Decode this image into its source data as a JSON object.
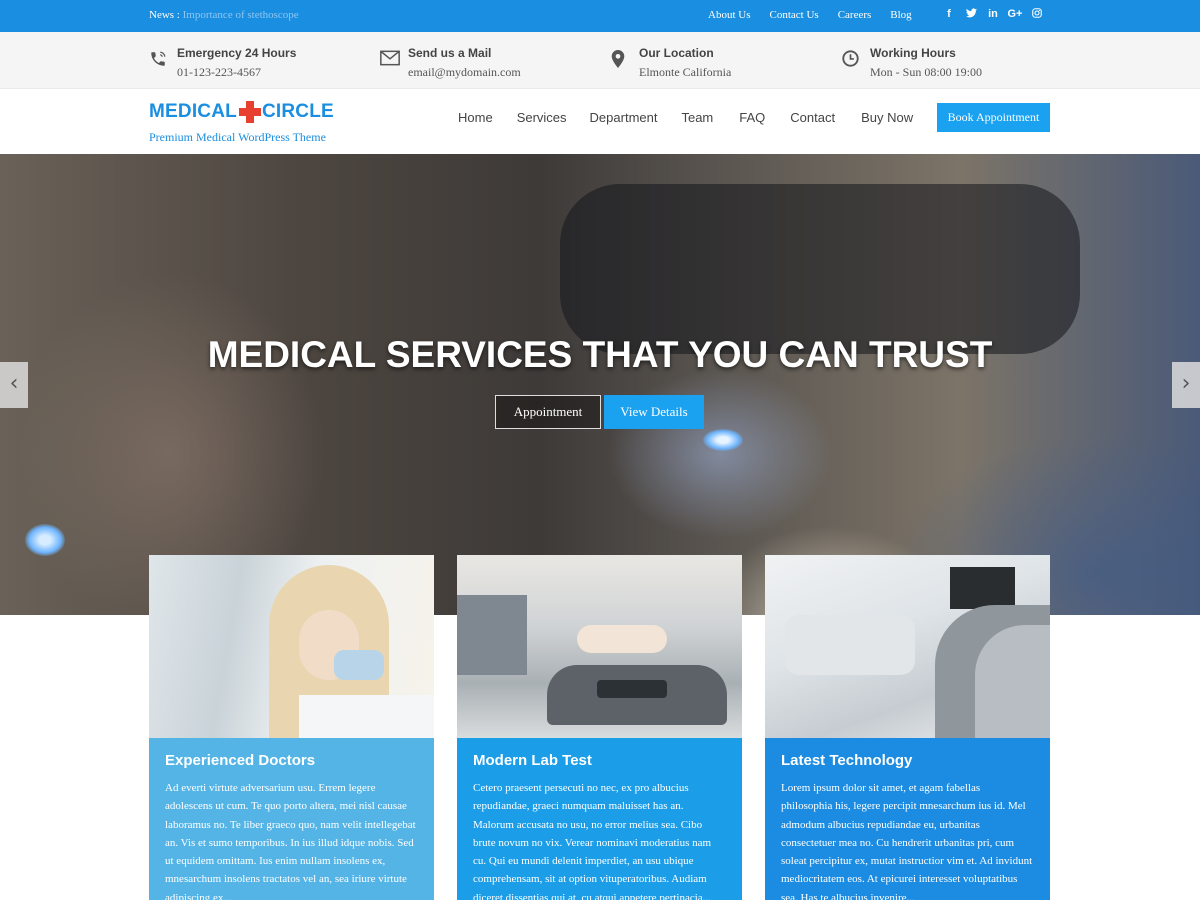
{
  "topbar": {
    "news_label": "News :",
    "news_text": "Importance of stethoscope",
    "links": [
      "About Us",
      "Contact Us",
      "Careers",
      "Blog"
    ],
    "social_icons": [
      "facebook-icon",
      "twitter-icon",
      "linkedin-icon",
      "google-plus-icon",
      "instagram-icon"
    ],
    "social_glyphs": [
      "f",
      "t",
      "in",
      "G+",
      "◎"
    ]
  },
  "info": [
    {
      "icon": "phone-icon",
      "title": "Emergency 24 Hours",
      "value": "01-123-223-4567"
    },
    {
      "icon": "mail-icon",
      "title": "Send us a Mail",
      "value": "email@mydomain.com"
    },
    {
      "icon": "location-pin-icon",
      "title": "Our Location",
      "value": "Elmonte California"
    },
    {
      "icon": "clock-icon",
      "title": "Working Hours",
      "value": "Mon - Sun 08:00 19:00"
    }
  ],
  "header": {
    "logo_left": "MEDICAL",
    "logo_right": "CIRCLE",
    "tagline": "Premium Medical WordPress Theme",
    "nav": [
      "Home",
      "Services",
      "Department",
      "Team",
      "FAQ",
      "Contact",
      "Buy Now"
    ],
    "book_label": "Book Appointment"
  },
  "hero": {
    "title": "MEDICAL SERVICES THAT YOU CAN TRUST",
    "appointment_label": "Appointment",
    "view_label": "View Details",
    "prev_glyph": "‹",
    "next_glyph": "›"
  },
  "cards": [
    {
      "title": "Experienced Doctors",
      "text": "Ad everti virtute adversarium usu. Errem legere adolescens ut cum. Te quo porto altera, mei nisl causae laboramus no. Te liber graeco quo, nam velit intellegebat an. Vis et sumo temporibus. In ius illud idque nobis. Sed ut equidem omittam. Ius enim nullam insolens ex, mnesarchum insolens tractatos vel an, sea iriure virtute adipiscing ex..."
    },
    {
      "title": "Modern Lab Test",
      "text": "Cetero praesent persecuti no nec, ex pro albucius repudiandae, graeci numquam maluisset has an. Malorum accusata no usu, no error melius sea. Cibo brute novum no vix. Verear nominavi moderatius nam cu. Qui eu mundi delenit imperdiet, an usu ubique comprehensam, sit at option vituperatoribus. Audiam diceret dissentias qui at, cu atqui appetere pertinacia..."
    },
    {
      "title": "Latest Technology",
      "text": "Lorem ipsum dolor sit amet, et agam fabellas philosophia his, legere percipit mnesarchum ius id. Mel admodum albucius repudiandae eu, urbanitas consectetuer mea no. Cu hendrerit urbanitas pri, cum soleat percipitur ex, mutat instructior vim et. Ad invidunt mediocritatem eos. At epicurei interesset voluptatibus sea. Has te albucius invenire..."
    }
  ],
  "colors": {
    "primary": "#1a8ee0",
    "button": "#1aa2f0",
    "logo_cross": "#e8402f",
    "card1": "#55b4e6",
    "card2": "#1c9de8",
    "card3": "#1b8ce2"
  }
}
